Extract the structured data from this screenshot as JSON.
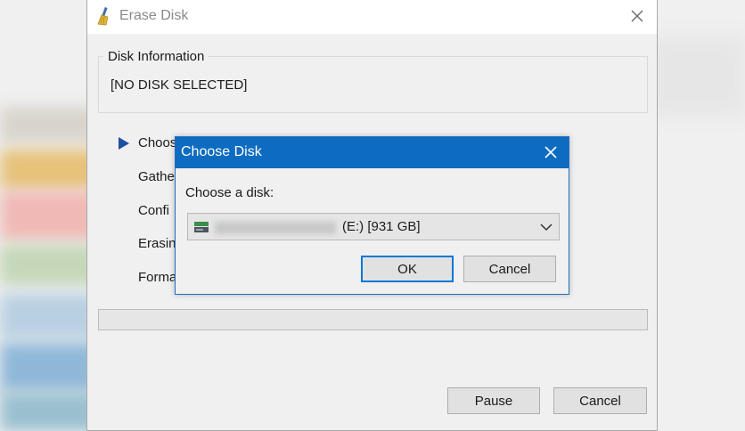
{
  "window": {
    "title": "Erase Disk",
    "title_icon": "broom-icon",
    "close_icon": "close-icon"
  },
  "disk_info": {
    "legend": "Disk Information",
    "value": "[NO DISK SELECTED]"
  },
  "steps": [
    {
      "label": "Choos",
      "active": true
    },
    {
      "label": "Gathe"
    },
    {
      "label": "Confi"
    },
    {
      "label": "Erasin"
    },
    {
      "label": "Forma"
    }
  ],
  "progress": {
    "value": 0
  },
  "buttons": {
    "pause": "Pause",
    "cancel": "Cancel"
  },
  "dialog": {
    "title": "Choose Disk",
    "label": "Choose a disk:",
    "selected_disk": "(E:) [931 GB]",
    "disk_icon": "drive-icon",
    "ok": "OK",
    "cancel": "Cancel"
  },
  "colors": {
    "dialog_titlebar": "#0d6cbf",
    "focus_border": "#0078d7",
    "step_arrow": "#1e4fa0"
  }
}
